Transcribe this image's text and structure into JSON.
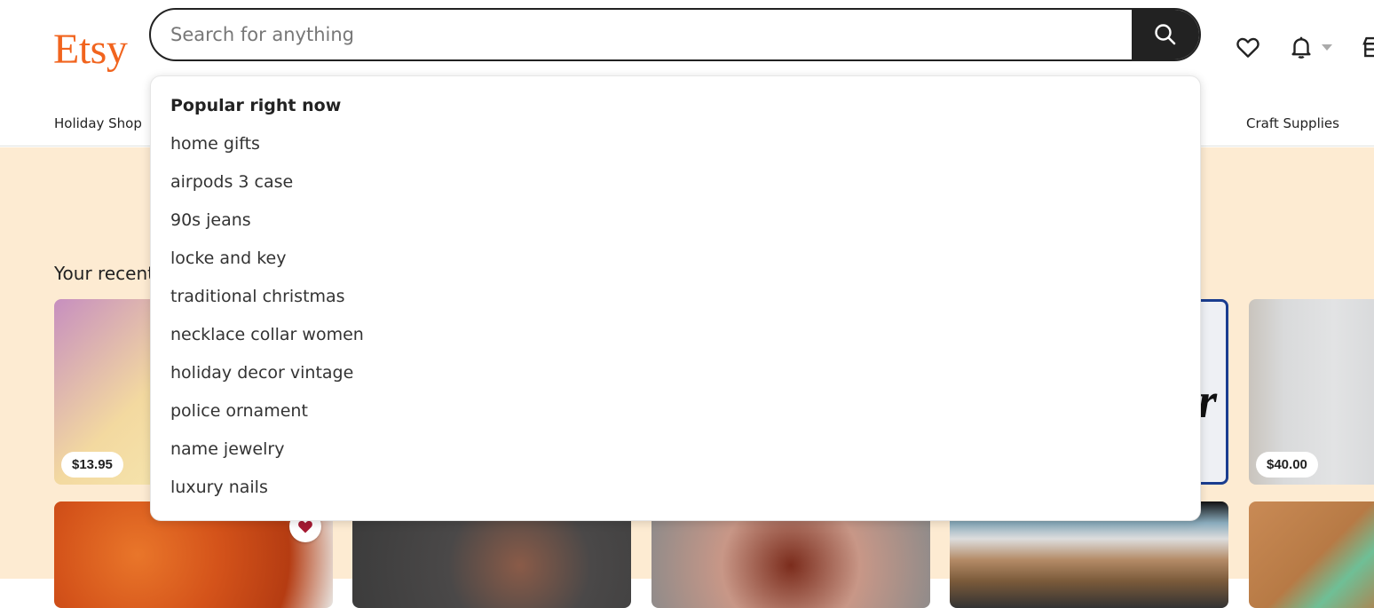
{
  "header": {
    "logo": "Etsy",
    "search": {
      "placeholder": "Search for anything",
      "value": ""
    },
    "icons": [
      "heart-icon",
      "bell-icon",
      "shop-icon"
    ]
  },
  "nav": {
    "items": [
      {
        "label": "Holiday Shop"
      },
      {
        "label": "Craft Supplies"
      }
    ]
  },
  "main": {
    "section_title": "Your recent",
    "cards": [
      {
        "price": "$13.95"
      },
      {
        "price": "$40.00"
      }
    ]
  },
  "dropdown": {
    "title": "Popular right now",
    "items": [
      "home gifts",
      "airpods 3 case",
      "90s jeans",
      "locke and key",
      "traditional christmas",
      "necklace collar women",
      "holiday decor vintage",
      "police ornament",
      "name jewelry",
      "luxury nails"
    ]
  },
  "colors": {
    "brand": "#f1641e",
    "background": "#fdebd2",
    "dark": "#222222"
  }
}
